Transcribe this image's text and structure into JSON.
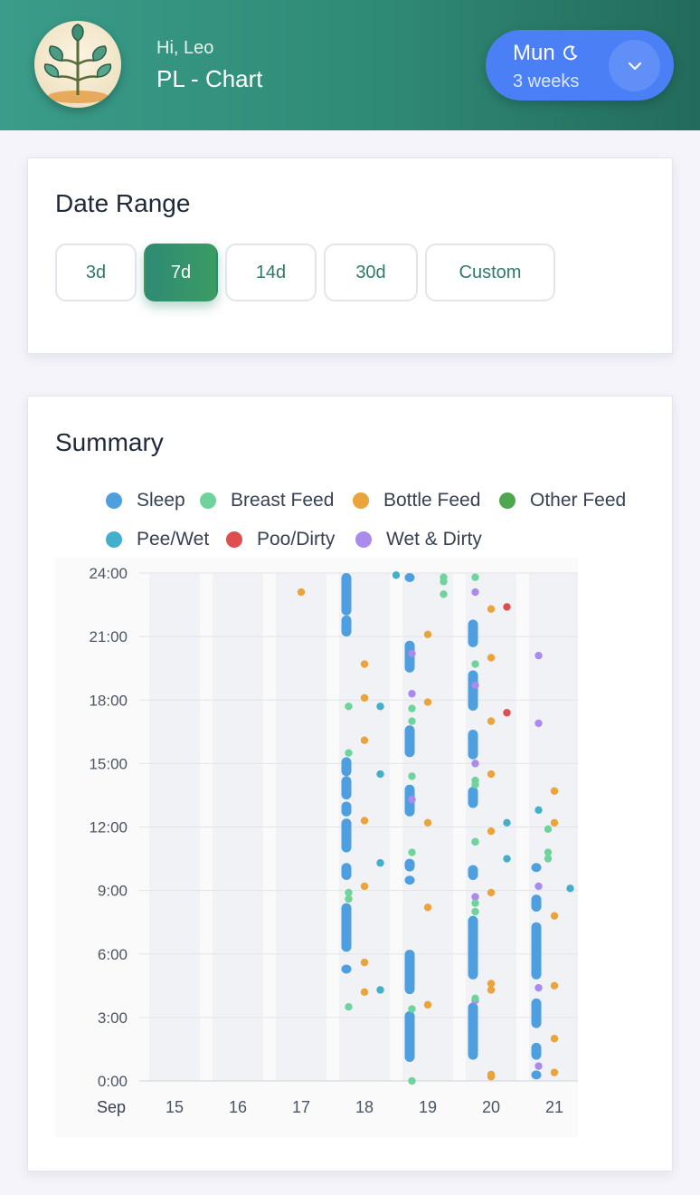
{
  "header": {
    "greeting": "Hi, Leo",
    "title": "PL - Chart",
    "profile": {
      "name": "Mun",
      "age": "3 weeks",
      "name_icon": "moon-icon",
      "toggle_icon": "chevron-down-icon"
    }
  },
  "date_range": {
    "title": "Date Range",
    "options": [
      "3d",
      "7d",
      "14d",
      "30d",
      "Custom"
    ],
    "selected": "7d"
  },
  "summary": {
    "title": "Summary",
    "legend": [
      {
        "key": "sleep",
        "label": "Sleep",
        "color": "#4e9fe0"
      },
      {
        "key": "breast",
        "label": "Breast Feed",
        "color": "#6fd49b"
      },
      {
        "key": "bottle",
        "label": "Bottle Feed",
        "color": "#eaa43a"
      },
      {
        "key": "other",
        "label": "Other Feed",
        "color": "#4ea64f"
      },
      {
        "key": "pee",
        "label": "Pee/Wet",
        "color": "#43afca"
      },
      {
        "key": "poo",
        "label": "Poo/Dirty",
        "color": "#de4e4e"
      },
      {
        "key": "both",
        "label": "Wet & Dirty",
        "color": "#a88bec"
      }
    ]
  },
  "chart_data": {
    "type": "scatter",
    "x_axis": {
      "month_label": "Sep",
      "days": [
        "15",
        "16",
        "17",
        "18",
        "19",
        "20",
        "21"
      ]
    },
    "y_axis": {
      "ticks": [
        "0:00",
        "3:00",
        "6:00",
        "9:00",
        "12:00",
        "15:00",
        "18:00",
        "21:00",
        "24:00"
      ],
      "range_hours": [
        0,
        24
      ]
    },
    "grid": true,
    "sleep": [
      {
        "day": "18",
        "start": 22.0,
        "end": 24.0
      },
      {
        "day": "18",
        "start": 21.0,
        "end": 22.0
      },
      {
        "day": "18",
        "start": 14.4,
        "end": 15.3
      },
      {
        "day": "18",
        "start": 13.3,
        "end": 14.4
      },
      {
        "day": "18",
        "start": 12.5,
        "end": 13.2
      },
      {
        "day": "18",
        "start": 10.8,
        "end": 12.4
      },
      {
        "day": "18",
        "start": 9.5,
        "end": 10.3
      },
      {
        "day": "18",
        "start": 6.1,
        "end": 8.4
      },
      {
        "day": "18",
        "start": 5.1,
        "end": 5.5
      },
      {
        "day": "19",
        "start": 23.7,
        "end": 24.0
      },
      {
        "day": "19",
        "start": 19.3,
        "end": 20.8
      },
      {
        "day": "19",
        "start": 15.3,
        "end": 16.8
      },
      {
        "day": "19",
        "start": 12.5,
        "end": 14.0
      },
      {
        "day": "19",
        "start": 9.9,
        "end": 10.5
      },
      {
        "day": "19",
        "start": 9.5,
        "end": 9.7
      },
      {
        "day": "19",
        "start": 4.1,
        "end": 6.2
      },
      {
        "day": "19",
        "start": 0.9,
        "end": 3.3
      },
      {
        "day": "20",
        "start": 20.5,
        "end": 21.8
      },
      {
        "day": "20",
        "start": 17.5,
        "end": 19.4
      },
      {
        "day": "20",
        "start": 15.2,
        "end": 16.6
      },
      {
        "day": "20",
        "start": 12.9,
        "end": 13.9
      },
      {
        "day": "20",
        "start": 9.5,
        "end": 10.2
      },
      {
        "day": "20",
        "start": 4.8,
        "end": 7.8
      },
      {
        "day": "20",
        "start": 1.0,
        "end": 3.7
      },
      {
        "day": "21",
        "start": 10.1,
        "end": 10.3
      },
      {
        "day": "21",
        "start": 8.0,
        "end": 8.8
      },
      {
        "day": "21",
        "start": 4.8,
        "end": 7.5
      },
      {
        "day": "21",
        "start": 2.5,
        "end": 3.9
      },
      {
        "day": "21",
        "start": 1.0,
        "end": 1.8
      },
      {
        "day": "21",
        "start": 0.3,
        "end": 0.5
      }
    ],
    "events": [
      {
        "type": "bottle",
        "day": "17",
        "hour": 23.1,
        "offset": 0
      },
      {
        "type": "pee",
        "day": "18",
        "hour": 23.9,
        "offset": 0.5
      },
      {
        "type": "bottle",
        "day": "18",
        "hour": 19.7,
        "offset": 0
      },
      {
        "type": "both",
        "day": "18",
        "hour": 20.2,
        "offset": 0.75
      },
      {
        "type": "both",
        "day": "18",
        "hour": 18.3,
        "offset": 0.75
      },
      {
        "type": "bottle",
        "day": "18",
        "hour": 18.1,
        "offset": 0
      },
      {
        "type": "breast",
        "day": "18",
        "hour": 17.7,
        "offset": -0.25
      },
      {
        "type": "pee",
        "day": "18",
        "hour": 17.7,
        "offset": 0.25
      },
      {
        "type": "bottle",
        "day": "18",
        "hour": 16.1,
        "offset": 0
      },
      {
        "type": "breast",
        "day": "18",
        "hour": 15.5,
        "offset": -0.25
      },
      {
        "type": "pee",
        "day": "18",
        "hour": 14.5,
        "offset": 0.25
      },
      {
        "type": "both",
        "day": "18",
        "hour": 13.3,
        "offset": 0.75
      },
      {
        "type": "bottle",
        "day": "18",
        "hour": 12.3,
        "offset": 0
      },
      {
        "type": "pee",
        "day": "18",
        "hour": 10.3,
        "offset": 0.25
      },
      {
        "type": "bottle",
        "day": "18",
        "hour": 9.2,
        "offset": 0
      },
      {
        "type": "breast",
        "day": "18",
        "hour": 8.9,
        "offset": -0.25
      },
      {
        "type": "breast",
        "day": "18",
        "hour": 8.6,
        "offset": -0.25
      },
      {
        "type": "bottle",
        "day": "18",
        "hour": 5.6,
        "offset": 0
      },
      {
        "type": "pee",
        "day": "18",
        "hour": 4.3,
        "offset": 0.25
      },
      {
        "type": "bottle",
        "day": "18",
        "hour": 4.2,
        "offset": 0
      },
      {
        "type": "breast",
        "day": "18",
        "hour": 3.5,
        "offset": -0.25
      },
      {
        "type": "breast",
        "day": "19",
        "hour": 23.8,
        "offset": 0.25
      },
      {
        "type": "breast",
        "day": "19",
        "hour": 23.6,
        "offset": 0.25
      },
      {
        "type": "breast",
        "day": "19",
        "hour": 23.0,
        "offset": 0.25
      },
      {
        "type": "both",
        "day": "19",
        "hour": 23.1,
        "offset": 0.75
      },
      {
        "type": "bottle",
        "day": "19",
        "hour": 21.1,
        "offset": 0
      },
      {
        "type": "both",
        "day": "19",
        "hour": 18.7,
        "offset": 0.75
      },
      {
        "type": "bottle",
        "day": "19",
        "hour": 17.9,
        "offset": 0
      },
      {
        "type": "breast",
        "day": "19",
        "hour": 17.6,
        "offset": -0.25
      },
      {
        "type": "breast",
        "day": "19",
        "hour": 17.0,
        "offset": -0.25
      },
      {
        "type": "both",
        "day": "19",
        "hour": 15.0,
        "offset": 0.75
      },
      {
        "type": "breast",
        "day": "19",
        "hour": 14.4,
        "offset": -0.25
      },
      {
        "type": "bottle",
        "day": "19",
        "hour": 12.2,
        "offset": 0
      },
      {
        "type": "both",
        "day": "19",
        "hour": 11.3,
        "offset": 0.75
      },
      {
        "type": "breast",
        "day": "19",
        "hour": 10.8,
        "offset": -0.25
      },
      {
        "type": "both",
        "day": "19",
        "hour": 8.7,
        "offset": 0.75
      },
      {
        "type": "bottle",
        "day": "19",
        "hour": 8.2,
        "offset": 0
      },
      {
        "type": "both",
        "day": "19",
        "hour": 3.8,
        "offset": 0.75
      },
      {
        "type": "bottle",
        "day": "19",
        "hour": 3.6,
        "offset": 0
      },
      {
        "type": "breast",
        "day": "19",
        "hour": 3.4,
        "offset": -0.25
      },
      {
        "type": "breast",
        "day": "19",
        "hour": 0.0,
        "offset": -0.25
      },
      {
        "type": "breast",
        "day": "20",
        "hour": 23.8,
        "offset": -0.25
      },
      {
        "type": "bottle",
        "day": "20",
        "hour": 22.3,
        "offset": 0
      },
      {
        "type": "poo",
        "day": "20",
        "hour": 22.4,
        "offset": 0.25
      },
      {
        "type": "both",
        "day": "20",
        "hour": 20.1,
        "offset": 0.75
      },
      {
        "type": "bottle",
        "day": "20",
        "hour": 20.0,
        "offset": 0
      },
      {
        "type": "breast",
        "day": "20",
        "hour": 19.7,
        "offset": -0.25
      },
      {
        "type": "poo",
        "day": "20",
        "hour": 17.4,
        "offset": 0.25
      },
      {
        "type": "bottle",
        "day": "20",
        "hour": 17.0,
        "offset": 0
      },
      {
        "type": "both",
        "day": "20",
        "hour": 16.9,
        "offset": 0.75
      },
      {
        "type": "bottle",
        "day": "20",
        "hour": 14.5,
        "offset": 0
      },
      {
        "type": "breast",
        "day": "20",
        "hour": 14.2,
        "offset": -0.25
      },
      {
        "type": "breast",
        "day": "20",
        "hour": 14.0,
        "offset": -0.25
      },
      {
        "type": "pee",
        "day": "20",
        "hour": 12.2,
        "offset": 0.25
      },
      {
        "type": "bottle",
        "day": "20",
        "hour": 11.8,
        "offset": 0
      },
      {
        "type": "breast",
        "day": "20",
        "hour": 11.3,
        "offset": -0.25
      },
      {
        "type": "pee",
        "day": "20",
        "hour": 10.5,
        "offset": 0.25
      },
      {
        "type": "both",
        "day": "20",
        "hour": 9.2,
        "offset": 0.75
      },
      {
        "type": "bottle",
        "day": "20",
        "hour": 8.9,
        "offset": 0
      },
      {
        "type": "breast",
        "day": "20",
        "hour": 8.4,
        "offset": -0.25
      },
      {
        "type": "breast",
        "day": "20",
        "hour": 8.0,
        "offset": -0.25
      },
      {
        "type": "bottle",
        "day": "20",
        "hour": 4.6,
        "offset": 0
      },
      {
        "type": "bottle",
        "day": "20",
        "hour": 4.3,
        "offset": 0
      },
      {
        "type": "both",
        "day": "20",
        "hour": 4.4,
        "offset": 0.75
      },
      {
        "type": "breast",
        "day": "20",
        "hour": 3.9,
        "offset": -0.25
      },
      {
        "type": "both",
        "day": "20",
        "hour": 0.7,
        "offset": 0.75
      },
      {
        "type": "bottle",
        "day": "20",
        "hour": 0.3,
        "offset": 0
      },
      {
        "type": "bottle",
        "day": "20",
        "hour": 0.2,
        "offset": 0
      },
      {
        "type": "bottle",
        "day": "21",
        "hour": 13.7,
        "offset": 0
      },
      {
        "type": "pee",
        "day": "21",
        "hour": 12.8,
        "offset": -0.25
      },
      {
        "type": "bottle",
        "day": "21",
        "hour": 12.2,
        "offset": 0
      },
      {
        "type": "breast",
        "day": "21",
        "hour": 11.9,
        "offset": -0.1
      },
      {
        "type": "both",
        "day": "21",
        "hour": 11.8,
        "offset": 0.75
      },
      {
        "type": "breast",
        "day": "21",
        "hour": 10.8,
        "offset": -0.1
      },
      {
        "type": "breast",
        "day": "21",
        "hour": 10.5,
        "offset": -0.1
      },
      {
        "type": "pee",
        "day": "21",
        "hour": 9.1,
        "offset": 0.25
      },
      {
        "type": "bottle",
        "day": "21",
        "hour": 7.8,
        "offset": 0
      },
      {
        "type": "both",
        "day": "21",
        "hour": 4.9,
        "offset": 0.75
      },
      {
        "type": "bottle",
        "day": "21",
        "hour": 4.5,
        "offset": 0
      },
      {
        "type": "bottle",
        "day": "21",
        "hour": 2.0,
        "offset": 0
      },
      {
        "type": "both",
        "day": "21",
        "hour": 0.6,
        "offset": 0.75
      },
      {
        "type": "bottle",
        "day": "21",
        "hour": 0.4,
        "offset": 0
      }
    ]
  }
}
